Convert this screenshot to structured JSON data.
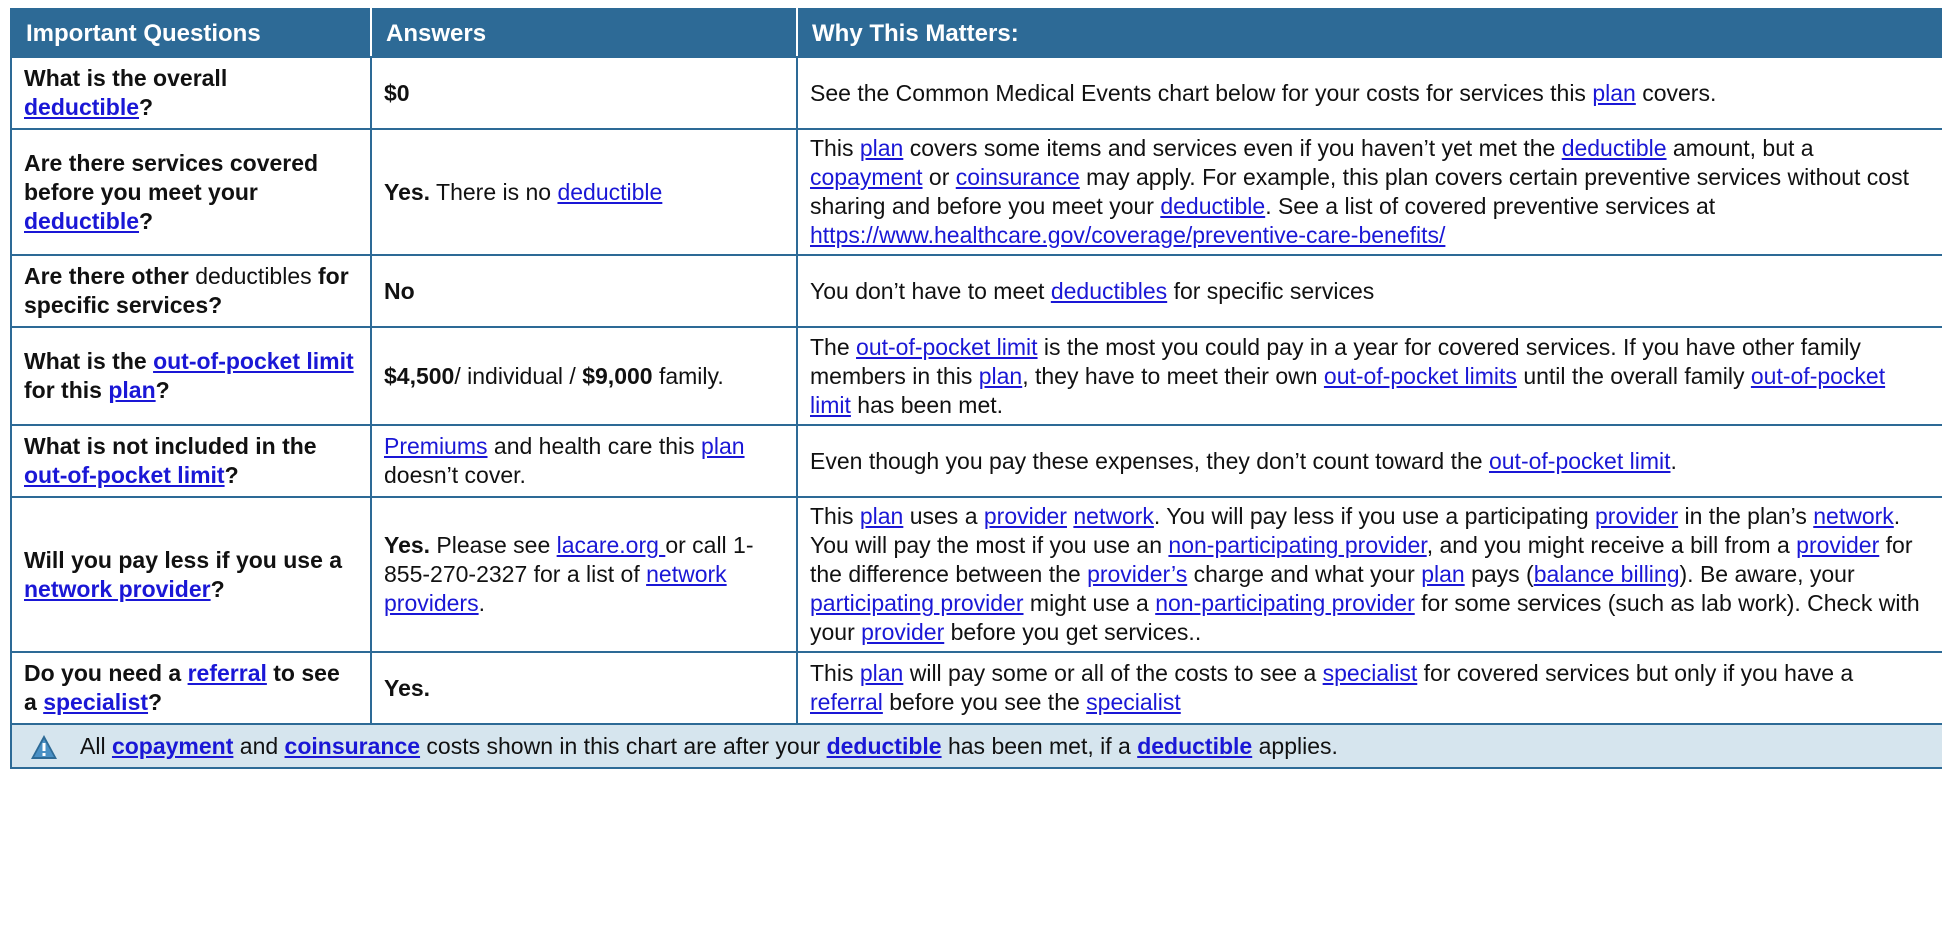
{
  "header": {
    "col_questions": "Important Questions",
    "col_answers": "Answers",
    "col_why": "Why This Matters:"
  },
  "rows": [
    {
      "q": [
        {
          "t": "What is the overall "
        },
        {
          "t": "deductible",
          "link": true
        },
        {
          "t": "?"
        }
      ],
      "a": [
        {
          "t": "$0",
          "bold": true
        }
      ],
      "w": [
        {
          "t": "See the Common Medical Events chart below for your costs for services this "
        },
        {
          "t": "plan",
          "link": true
        },
        {
          "t": " covers."
        }
      ]
    },
    {
      "q": [
        {
          "t": "Are there services covered before you meet your "
        },
        {
          "t": "deductible",
          "link": true
        },
        {
          "t": "?"
        }
      ],
      "a": [
        {
          "t": "Yes.",
          "bold": true
        },
        {
          "t": "  There is no "
        },
        {
          "t": "deductible",
          "link": true
        }
      ],
      "w": [
        {
          "t": "This "
        },
        {
          "t": "plan",
          "link": true
        },
        {
          "t": " covers some items and services even if you haven’t yet met the "
        },
        {
          "t": "deductible",
          "link": true
        },
        {
          "t": " amount, but a "
        },
        {
          "t": "copayment",
          "link": true
        },
        {
          "t": " or "
        },
        {
          "t": "coinsurance",
          "link": true
        },
        {
          "t": " may apply.  For example, this plan covers certain preventive services without cost sharing and before you meet your "
        },
        {
          "t": "deductible",
          "link": true
        },
        {
          "t": ". See a list of covered preventive services at "
        },
        {
          "t": "https://www.healthcare.gov/coverage/preventive-care-benefits/",
          "link": true
        }
      ]
    },
    {
      "q": [
        {
          "t": "Are there other "
        },
        {
          "t": "deductibles",
          "normal": true
        },
        {
          "t": " for specific services?"
        }
      ],
      "a": [
        {
          "t": "No",
          "bold": true
        }
      ],
      "w": [
        {
          "t": "You don’t have to meet "
        },
        {
          "t": "deductibles",
          "link": true
        },
        {
          "t": " for specific services"
        }
      ]
    },
    {
      "q": [
        {
          "t": "What is the "
        },
        {
          "t": "out-of-pocket limit",
          "link": true
        },
        {
          "t": " for this "
        },
        {
          "t": "plan",
          "link": true
        },
        {
          "t": "?"
        }
      ],
      "a": [
        {
          "t": "$4,500",
          "bold": true
        },
        {
          "t": "/ individual / "
        },
        {
          "t": "$9,000",
          "bold": true
        },
        {
          "t": " family."
        }
      ],
      "w": [
        {
          "t": "The "
        },
        {
          "t": "out-of-pocket limit",
          "link": true
        },
        {
          "t": " is the most you could pay in a year for covered services. If you have other family members in this "
        },
        {
          "t": "plan",
          "link": true
        },
        {
          "t": ", they have to meet their own "
        },
        {
          "t": "out-of-pocket limits",
          "link": true
        },
        {
          "t": " until the overall family "
        },
        {
          "t": "out-of-pocket limit",
          "link": true
        },
        {
          "t": " has been met."
        }
      ]
    },
    {
      "q": [
        {
          "t": "What is not included in the "
        },
        {
          "t": "out-of-pocket limit",
          "link": true
        },
        {
          "t": "?"
        }
      ],
      "a": [
        {
          "t": "Premiums",
          "link": true
        },
        {
          "t": " and health care this "
        },
        {
          "t": "plan",
          "link": true
        },
        {
          "t": " doesn’t cover."
        }
      ],
      "w": [
        {
          "t": "Even though you pay these expenses, they don’t count toward the "
        },
        {
          "t": "out-of-pocket limit",
          "link": true
        },
        {
          "t": "."
        }
      ]
    },
    {
      "q": [
        {
          "t": "Will you pay less if you use a "
        },
        {
          "t": "network provider",
          "link": true
        },
        {
          "t": "?"
        }
      ],
      "a": [
        {
          "t": "Yes.",
          "bold": true
        },
        {
          "t": " Please see "
        },
        {
          "t": "lacare.org ",
          "link": true
        },
        {
          "t": " or call 1-855-270-2327 for a list of "
        },
        {
          "t": "network",
          "link": true
        },
        {
          "t": " "
        },
        {
          "t": "providers",
          "link": true
        },
        {
          "t": "."
        }
      ],
      "w": [
        {
          "t": "This "
        },
        {
          "t": "plan",
          "link": true
        },
        {
          "t": " uses a "
        },
        {
          "t": "provider",
          "link": true
        },
        {
          "t": " "
        },
        {
          "t": "network",
          "link": true
        },
        {
          "t": ". You will pay less if you use a participating "
        },
        {
          "t": "provider",
          "link": true
        },
        {
          "t": " in the plan’s "
        },
        {
          "t": "network",
          "link": true
        },
        {
          "t": ". You will pay the most if you use an "
        },
        {
          "t": "non-participating provider",
          "link": true
        },
        {
          "t": ", and you might receive a bill from a "
        },
        {
          "t": "provider",
          "link": true
        },
        {
          "t": " for the difference between the "
        },
        {
          "t": "provider’s",
          "link": true
        },
        {
          "t": " charge and what your "
        },
        {
          "t": "plan",
          "link": true
        },
        {
          "t": " pays ("
        },
        {
          "t": "balance billing",
          "link": true
        },
        {
          "t": "). Be aware, your "
        },
        {
          "t": "participating provider",
          "link": true
        },
        {
          "t": " might use a "
        },
        {
          "t": "non-participating provider",
          "link": true
        },
        {
          "t": " for some services (such as lab work). Check with your "
        },
        {
          "t": "provider",
          "link": true
        },
        {
          "t": " before you get services.."
        }
      ]
    },
    {
      "q": [
        {
          "t": "Do you need a "
        },
        {
          "t": "referral",
          "link": true
        },
        {
          "t": " to see a "
        },
        {
          "t": "specialist",
          "link": true
        },
        {
          "t": "?"
        }
      ],
      "a": [
        {
          "t": "Yes.",
          "bold": true
        }
      ],
      "w": [
        {
          "t": "This "
        },
        {
          "t": "plan",
          "link": true
        },
        {
          "t": " will pay some or all of the costs to see a "
        },
        {
          "t": "specialist",
          "link": true
        },
        {
          "t": " for covered services but only if you have a "
        },
        {
          "t": "referral",
          "link": true
        },
        {
          "t": " before you see the "
        },
        {
          "t": "specialist",
          "link": true
        }
      ]
    }
  ],
  "footnote": {
    "icon": "warning-triangle-icon",
    "parts": [
      {
        "t": "All "
      },
      {
        "t": "copayment",
        "link": true
      },
      {
        "t": " and "
      },
      {
        "t": "coinsurance",
        "link": true
      },
      {
        "t": " costs shown in this chart are after your "
      },
      {
        "t": "deductible",
        "link": true
      },
      {
        "t": " has been met, if a "
      },
      {
        "t": "deductible",
        "link": true
      },
      {
        "t": " applies."
      }
    ]
  },
  "colors": {
    "header_bg": "#2d6a96",
    "border": "#2d6a96",
    "link": "#1a17d6",
    "footnote_bg": "#d6e5ee"
  }
}
